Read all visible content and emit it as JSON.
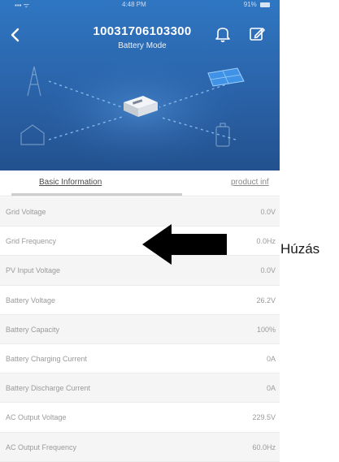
{
  "status_bar": {
    "time": "4:48 PM",
    "battery": "91%"
  },
  "header": {
    "device_id": "10031706103300",
    "mode": "Battery Mode"
  },
  "tabs": [
    {
      "label": "Basic Information",
      "active": true
    },
    {
      "label": "product inf",
      "active": false
    }
  ],
  "rows": [
    {
      "label": "Grid Voltage",
      "value": "0.0V"
    },
    {
      "label": "Grid Frequency",
      "value": "0.0Hz"
    },
    {
      "label": "PV Input Voltage",
      "value": "0.0V"
    },
    {
      "label": "Battery Voltage",
      "value": "26.2V"
    },
    {
      "label": "Battery Capacity",
      "value": "100%"
    },
    {
      "label": "Battery Charging Current",
      "value": "0A"
    },
    {
      "label": "Battery Discharge Current",
      "value": "0A"
    },
    {
      "label": "AC Output Voltage",
      "value": "229.5V"
    },
    {
      "label": "AC Output Frequency",
      "value": "60.0Hz"
    }
  ],
  "overlay": {
    "caption": "Húzás",
    "arrow_icon": "left-arrow-icon"
  },
  "colors": {
    "header_top": "#2f76c2",
    "header_bottom": "#23518f",
    "row_alt": "#f5f5f5",
    "text_muted": "#9a9a9a"
  }
}
